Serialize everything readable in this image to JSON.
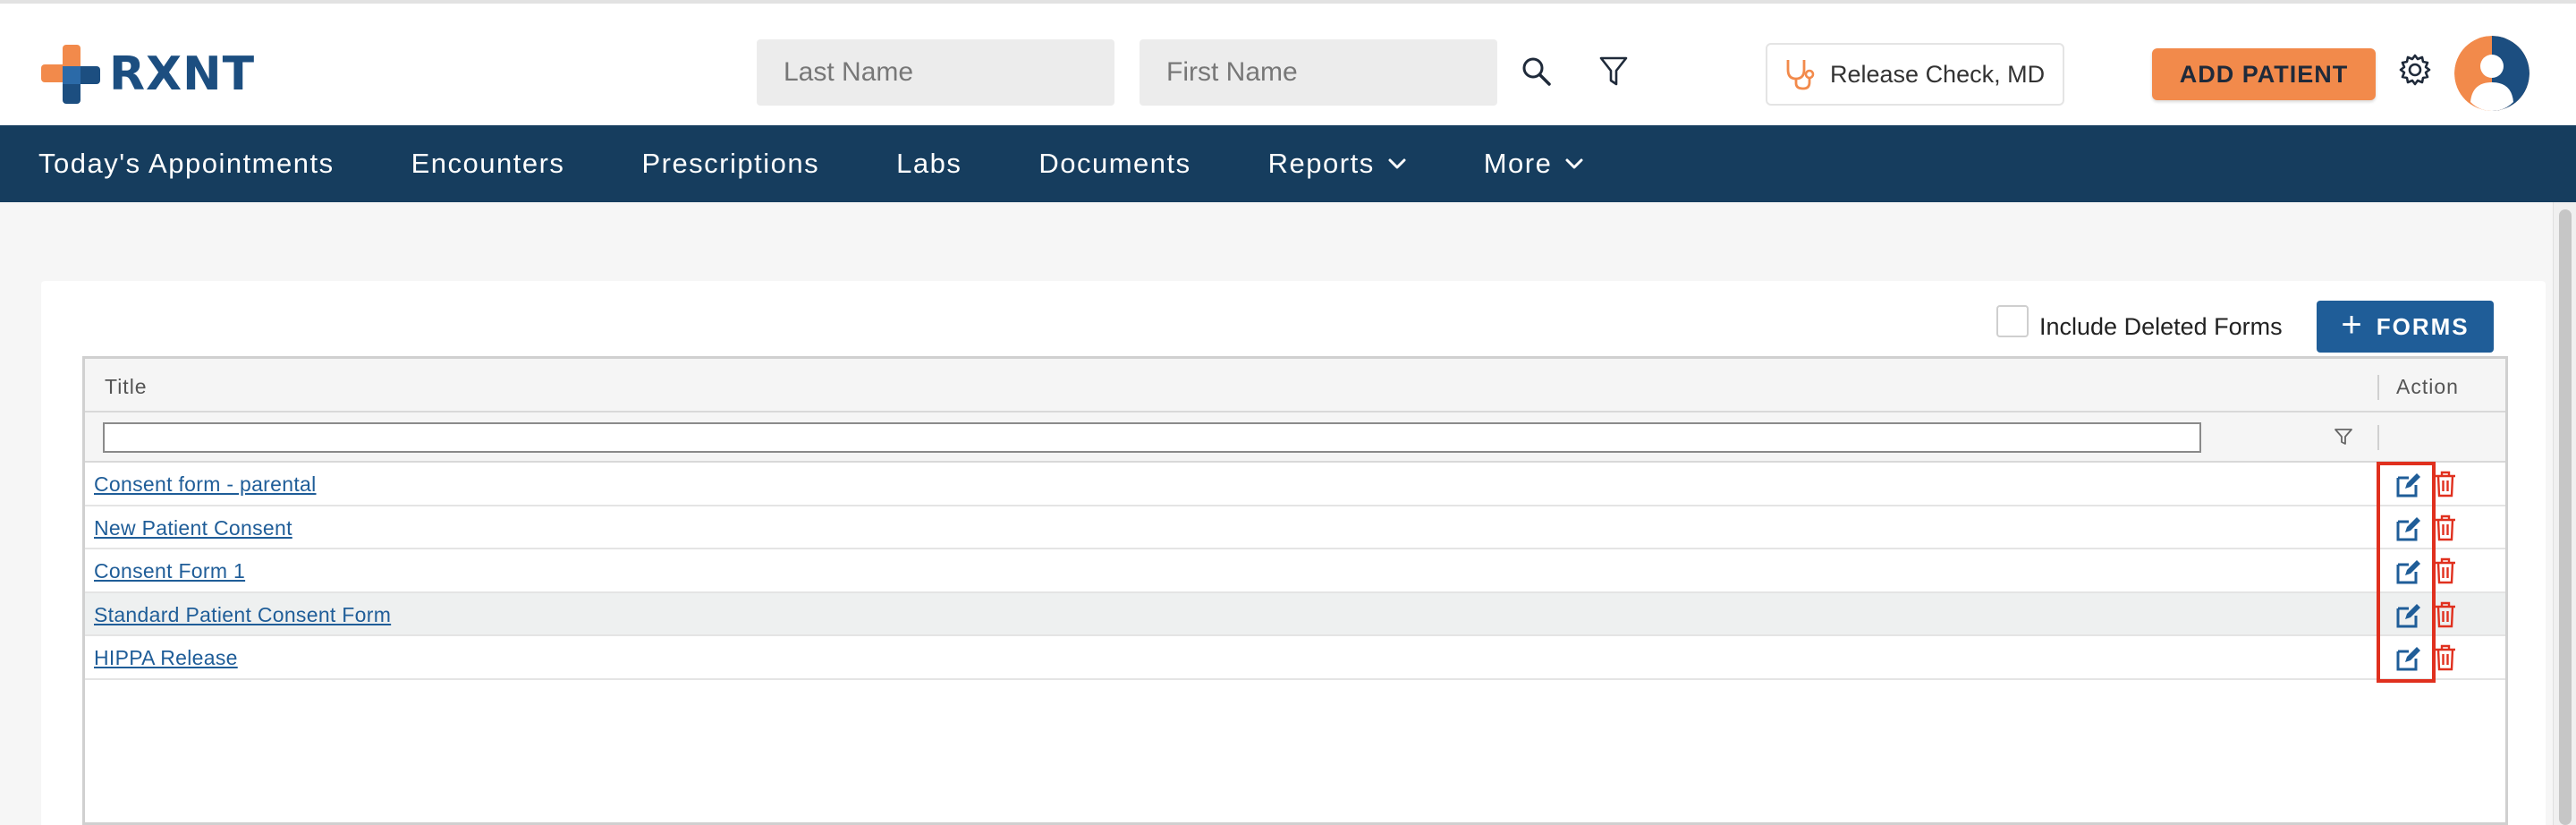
{
  "header": {
    "logo_text": "RXNT",
    "search": {
      "last_name_placeholder": "Last Name",
      "first_name_placeholder": "First Name"
    },
    "provider": "Release Check, MD",
    "add_patient": "ADD PATIENT",
    "icons": {
      "search": "search-icon",
      "filter": "filter-icon",
      "stethoscope": "stethoscope-icon",
      "settings": "gear-icon",
      "avatar": "user-avatar-icon"
    }
  },
  "nav": {
    "items": [
      {
        "label": "Today's Appointments"
      },
      {
        "label": "Encounters"
      },
      {
        "label": "Prescriptions"
      },
      {
        "label": "Labs"
      },
      {
        "label": "Documents"
      },
      {
        "label": "Reports"
      },
      {
        "label": "More"
      }
    ]
  },
  "toolbar": {
    "include_deleted_label": "Include Deleted Forms",
    "include_deleted_checked": false,
    "forms_button": "FORMS"
  },
  "grid": {
    "columns": {
      "title": "Title",
      "action": "Action"
    },
    "filter_value": "",
    "rows": [
      {
        "title": "Consent form - parental"
      },
      {
        "title": "New Patient Consent"
      },
      {
        "title": "Consent Form 1"
      },
      {
        "title": "Standard Patient Consent Form"
      },
      {
        "title": "HIPPA Release"
      }
    ]
  },
  "colors": {
    "brand_blue": "#1c4e80",
    "nav_bg": "#163d5e",
    "accent_orange": "#f28a4b",
    "link_blue": "#1f5d98",
    "delete_red": "#e0301e",
    "highlight_red": "#e0301e"
  }
}
